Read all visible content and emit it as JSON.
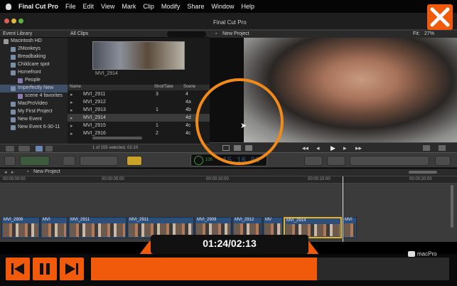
{
  "menubar": {
    "apple": "",
    "app": "Final Cut Pro",
    "items": [
      "File",
      "Edit",
      "View",
      "Mark",
      "Clip",
      "Modify",
      "Share",
      "Window",
      "Help"
    ]
  },
  "event_library": {
    "title": "Event Library",
    "filter": "All Clips",
    "tree": [
      {
        "label": "Macintosh HD",
        "indent": 0
      },
      {
        "label": "2Monkeys",
        "indent": 1
      },
      {
        "label": "Breadbaking",
        "indent": 1
      },
      {
        "label": "Childcare spot",
        "indent": 1
      },
      {
        "label": "Homefront",
        "indent": 1
      },
      {
        "label": "People",
        "indent": 2
      },
      {
        "label": "Imperfectly New",
        "indent": 1,
        "selected": true
      },
      {
        "label": "scene 4 favorites",
        "indent": 2
      },
      {
        "label": "MacProVideo",
        "indent": 1
      },
      {
        "label": "My First Project",
        "indent": 1
      },
      {
        "label": "New Event",
        "indent": 1
      },
      {
        "label": "New Event 6-30-11",
        "indent": 1
      }
    ],
    "thumb_label": "MVI_2914",
    "columns": {
      "name": "Name",
      "shot": "Shot/Take",
      "scene": "Scene"
    },
    "rows": [
      {
        "name": "MVI_2911",
        "shot": "3",
        "scene": "4"
      },
      {
        "name": "MVI_2912",
        "shot": "",
        "scene": "4a"
      },
      {
        "name": "MVI_2913",
        "shot": "1",
        "scene": "4b"
      },
      {
        "name": "MVI_2914",
        "shot": "",
        "scene": "4d",
        "selected": true
      },
      {
        "name": "MVI_2915",
        "shot": "1",
        "scene": "4c"
      },
      {
        "name": "MVI_2916",
        "shot": "2",
        "scene": "4c"
      }
    ],
    "status": "1 of 155 selected, 02:10"
  },
  "viewer": {
    "app_title": "Final Cut Pro",
    "project": "New Project",
    "fit_label": "Fit:",
    "fit_value": "27%"
  },
  "toolbar": {
    "timecode": "15.16.00",
    "timecode_sub": "100"
  },
  "timeline": {
    "project": "New Project",
    "ruler": [
      "00:00:00:00",
      "00:00:05:00",
      "00:00:10:00",
      "00:00:15:00",
      "00:00:20:00"
    ],
    "clips": [
      {
        "label": "MVI_2909"
      },
      {
        "label": "MVI"
      },
      {
        "label": "MVI_2911"
      },
      {
        "label": "MVI_2911"
      },
      {
        "label": "MVI_2909"
      },
      {
        "label": "MVI_2912"
      },
      {
        "label": "MV"
      },
      {
        "label": "MVI_2914",
        "selected": true
      },
      {
        "label": "MVI"
      }
    ]
  },
  "player": {
    "time": "01:24/02:13",
    "progress": 0.63,
    "brand": "macPro"
  },
  "colors": {
    "accent": "#f05a0a",
    "selection": "#e6b21f",
    "clip": "#2d4f7c"
  }
}
